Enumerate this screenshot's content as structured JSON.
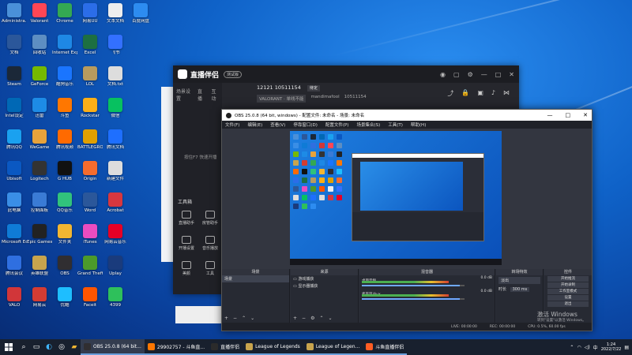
{
  "desktop": {
    "icons": [
      {
        "label": "Administra...",
        "color": "#4a90d9"
      },
      {
        "label": "文档",
        "color": "#2b579a"
      },
      {
        "label": "Steam",
        "color": "#1b2838"
      },
      {
        "label": "Intel设定",
        "color": "#0068b5"
      },
      {
        "label": "腾讯QQ",
        "color": "#1aa1f0"
      },
      {
        "label": "Ubisoft",
        "color": "#0a58c2"
      },
      {
        "label": "此电脑",
        "color": "#3a8ee6"
      },
      {
        "label": "Microsoft Edge",
        "color": "#0f7bd6"
      },
      {
        "label": "腾讯会议",
        "color": "#2f6fe0"
      },
      {
        "label": "VALO",
        "color": "#d13639"
      },
      {
        "label": "Valorant",
        "color": "#ff4655"
      },
      {
        "label": "回收站",
        "color": "#5d8ec2"
      },
      {
        "label": "GeForce",
        "color": "#76b900"
      },
      {
        "label": "迅雷",
        "color": "#1d8be6"
      },
      {
        "label": "WeGame",
        "color": "#e8a33b"
      },
      {
        "label": "Logitech",
        "color": "#333333"
      },
      {
        "label": "控制面板",
        "color": "#3a7bd5"
      },
      {
        "label": "Epic Games",
        "color": "#222222"
      },
      {
        "label": "英雄联盟",
        "color": "#c8a44d"
      },
      {
        "label": "网易云",
        "color": "#d43c33"
      },
      {
        "label": "Chrome",
        "color": "#34a853"
      },
      {
        "label": "Internet Explorer",
        "color": "#1e88e5"
      },
      {
        "label": "酷狗音乐",
        "color": "#1a75ff"
      },
      {
        "label": "斗鱼",
        "color": "#ff7700"
      },
      {
        "label": "腾讯视频",
        "color": "#ff6a00"
      },
      {
        "label": "G HUB",
        "color": "#111111"
      },
      {
        "label": "QQ音乐",
        "color": "#31c27c"
      },
      {
        "label": "文件夹",
        "color": "#f2b632"
      },
      {
        "label": "OBS",
        "color": "#302e31"
      },
      {
        "label": "优酷",
        "color": "#1ebeff"
      },
      {
        "label": "网易UU",
        "color": "#2b6de8"
      },
      {
        "label": "Excel",
        "color": "#1d6f42"
      },
      {
        "label": "LOL",
        "color": "#b89b5e"
      },
      {
        "label": "Rockstar",
        "color": "#fcaf17"
      },
      {
        "label": "BATTLEGROUNDS",
        "color": "#e0a000"
      },
      {
        "label": "Origin",
        "color": "#f56c2d"
      },
      {
        "label": "Word",
        "color": "#2b579a"
      },
      {
        "label": "iTunes",
        "color": "#ea4cc0"
      },
      {
        "label": "Grand Theft Auto V",
        "color": "#4c9a2a"
      },
      {
        "label": "Faceit",
        "color": "#ff5500"
      },
      {
        "label": "文本文档",
        "color": "#eeeeee"
      },
      {
        "label": "飞书",
        "color": "#3370ff"
      },
      {
        "label": "文档.txt",
        "color": "#dddddd"
      },
      {
        "label": "微信",
        "color": "#07c160"
      },
      {
        "label": "腾讯文档",
        "color": "#1e6fff"
      },
      {
        "label": "新建文件",
        "color": "#dddddd"
      },
      {
        "label": "Acrobat",
        "color": "#d7373f"
      },
      {
        "label": "网易云音乐",
        "color": "#e60026"
      },
      {
        "label": "Uplay",
        "color": "#1a3b7c"
      },
      {
        "label": "4399",
        "color": "#2ec05b"
      },
      {
        "label": "百度网盘",
        "color": "#2d8cf0"
      }
    ]
  },
  "assistant_window": {
    "app_name": "直播伴侣",
    "version_badge": "测试版",
    "tabs": [
      "场景设置",
      "直播",
      "互动"
    ],
    "hint": "按住F7 快速开播",
    "tools_header": "工具箱",
    "tools": [
      "直播助手",
      "房管助手",
      "开播设置",
      "音乐播放",
      "美颜",
      "工具"
    ],
    "room_line": "12121  10511154",
    "room_tag": "待定",
    "game_line": "VALORANT · 单线不能",
    "streamer": "mandimafool",
    "streamer_id": "10511154",
    "right_badge": "待定"
  },
  "obs": {
    "title": "OBS 25.0.8 (64 bit, windows) - 配置文件: 未命名 - 场景: 未命名",
    "menu": [
      "文件(F)",
      "编辑(E)",
      "查看(V)",
      "停靠窗口(D)",
      "配置文件(P)",
      "场景集合(S)",
      "工具(T)",
      "帮助(H)"
    ],
    "docks": {
      "scenes": {
        "title": "场景",
        "items": [
          "场景"
        ]
      },
      "sources": {
        "title": "来源",
        "items": [
          "游戏捕获",
          "显示器捕获"
        ]
      },
      "mixer": {
        "title": "混音器",
        "channels": [
          {
            "name": "桌面音频",
            "db": "0.0 dB"
          },
          {
            "name": "麦克风/Aux",
            "db": "0.0 dB"
          }
        ]
      },
      "transitions": {
        "title": "转场特效",
        "type": "淡出",
        "duration_label": "时长",
        "duration": "300 ms"
      },
      "controls": {
        "title": "控件",
        "buttons": [
          "开始推流",
          "开始录制",
          "工作室模式",
          "设置",
          "退出"
        ]
      }
    },
    "status": {
      "live": "LIVE: 00:00:00",
      "rec": "REC: 00:00:00",
      "cpu": "CPU: 0.5%, 60.00 fps"
    }
  },
  "watermark": {
    "line1": "激活 Windows",
    "line2": "转到\"设置\"以激活 Windows。"
  },
  "taskbar": {
    "apps": [
      {
        "label": "OBS 25.0.8 (64 bit...",
        "color": "#302e31",
        "active": true
      },
      {
        "label": "29902757 - 斗鱼直...",
        "color": "#ff7700",
        "active": false
      },
      {
        "label": "直播伴侣",
        "color": "#2b2b2b",
        "active": false
      },
      {
        "label": "League of Legends",
        "color": "#c8a44d",
        "active": false
      },
      {
        "label": "League of Legen...",
        "color": "#c8a44d",
        "active": false
      },
      {
        "label": "斗鱼直播伴侣",
        "color": "#ff5d23",
        "active": false
      }
    ],
    "time": "1:24",
    "date": "2022/7/22"
  }
}
